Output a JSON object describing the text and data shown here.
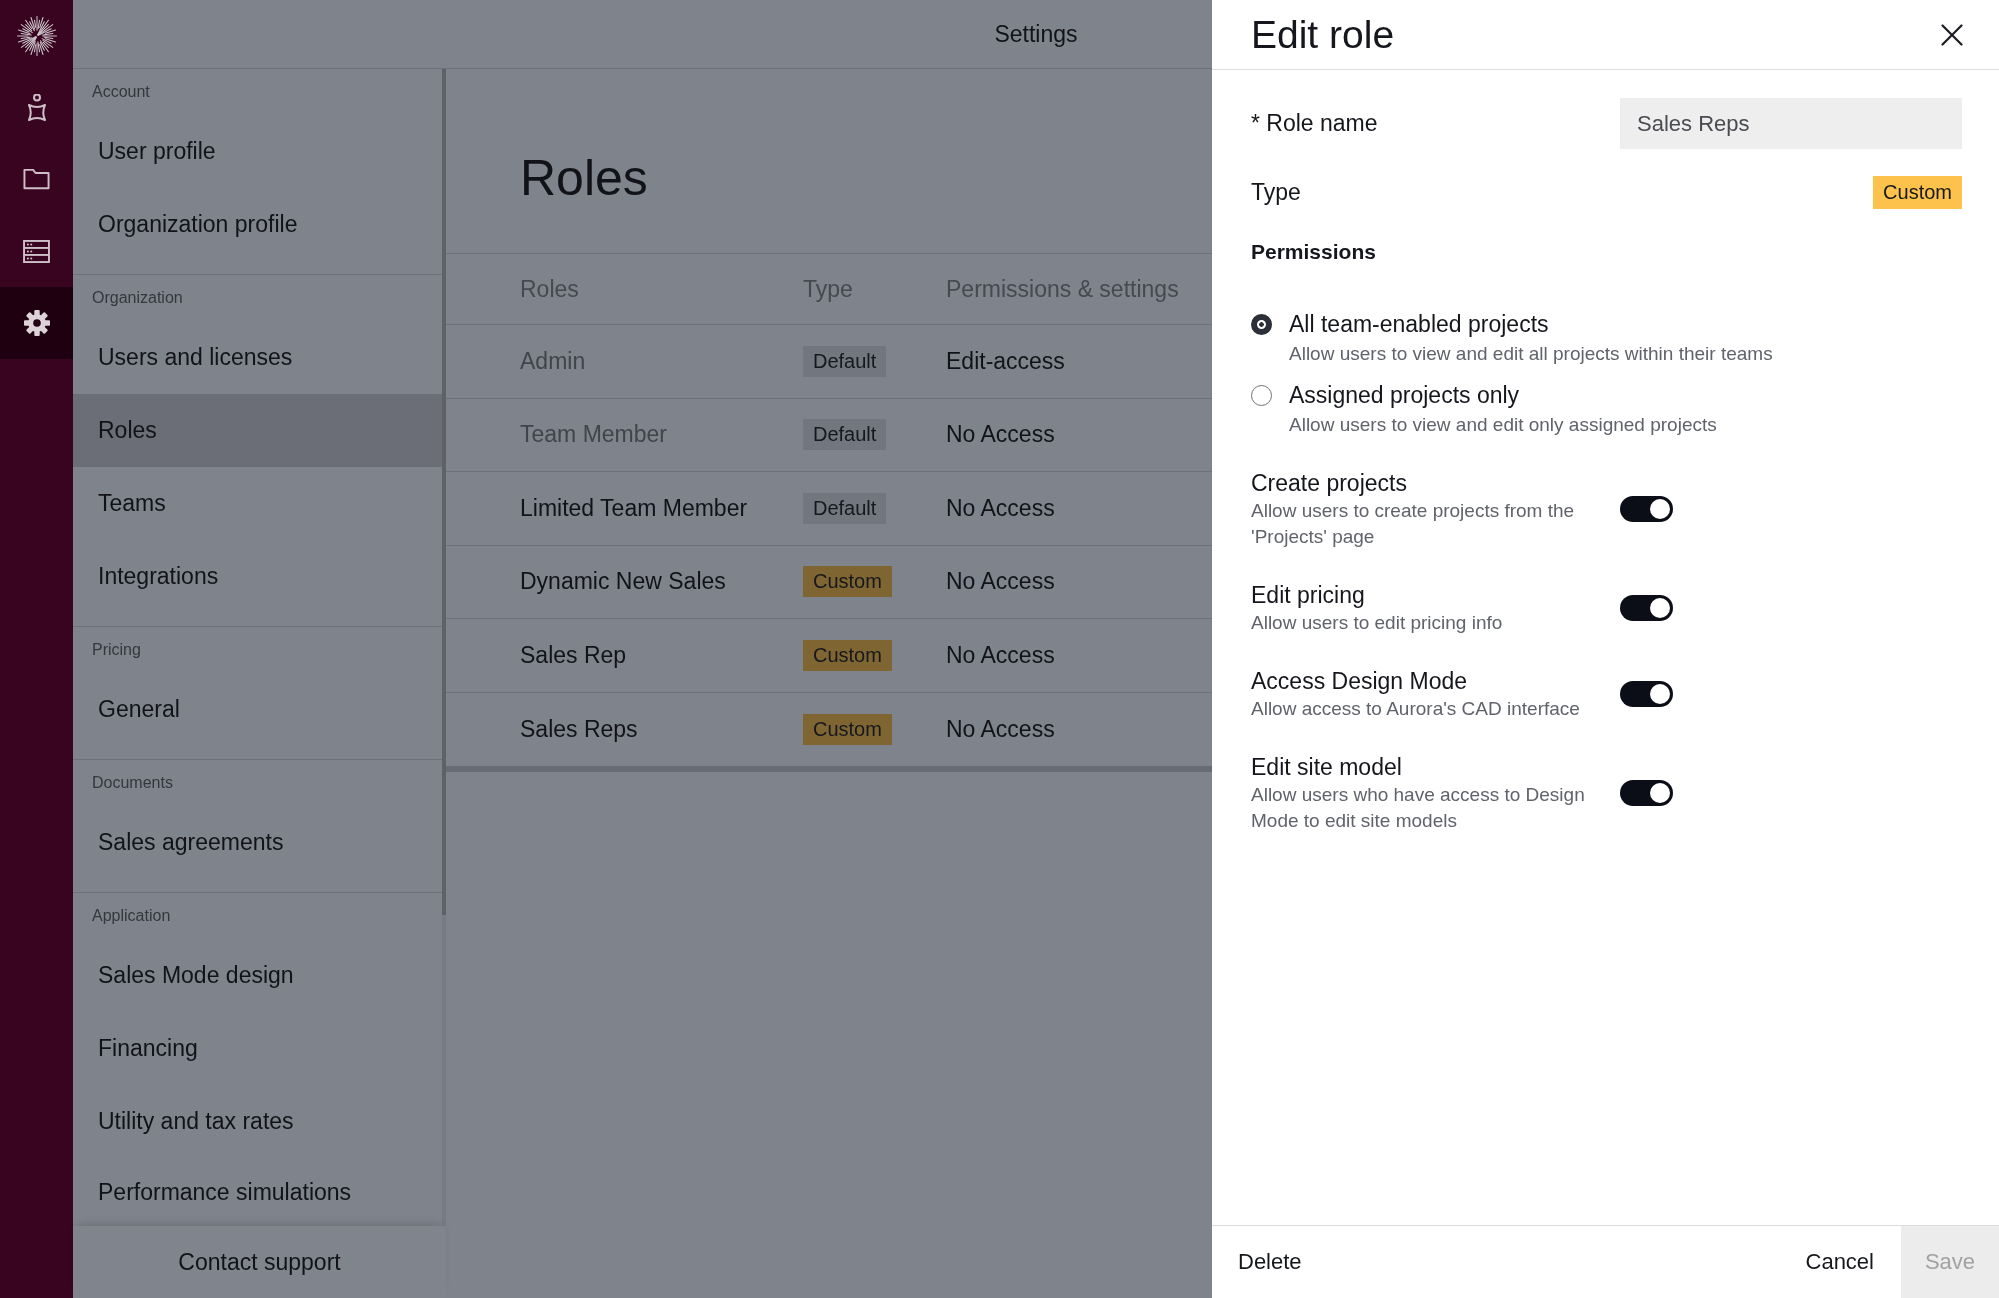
{
  "rail": {
    "items": [
      {
        "selected": false
      },
      {
        "selected": false
      },
      {
        "selected": false
      },
      {
        "selected": true
      }
    ]
  },
  "header": {
    "title": "Settings"
  },
  "sidebar": {
    "sections": [
      {
        "label": "Account",
        "items": [
          {
            "label": "User profile",
            "selected": false
          },
          {
            "label": "Organization profile",
            "selected": false
          }
        ]
      },
      {
        "label": "Organization",
        "items": [
          {
            "label": "Users and licenses",
            "selected": false
          },
          {
            "label": "Roles",
            "selected": true
          },
          {
            "label": "Teams",
            "selected": false
          },
          {
            "label": "Integrations",
            "selected": false
          }
        ]
      },
      {
        "label": "Pricing",
        "items": [
          {
            "label": "General",
            "selected": false
          }
        ]
      },
      {
        "label": "Documents",
        "items": [
          {
            "label": "Sales agreements",
            "selected": false
          }
        ]
      },
      {
        "label": "Application",
        "items": [
          {
            "label": "Sales Mode design",
            "selected": false
          },
          {
            "label": "Financing",
            "selected": false
          },
          {
            "label": "Utility and tax rates",
            "selected": false
          },
          {
            "label": "Performance simulations",
            "selected": false
          }
        ]
      }
    ],
    "footer_link": "Contact support"
  },
  "roles_page": {
    "title": "Roles",
    "table": {
      "columns": [
        "Roles",
        "Type",
        "Permissions & settings"
      ],
      "rows": [
        {
          "name": "Admin",
          "disabled": true,
          "type": {
            "label": "Default",
            "kind": "default"
          },
          "permissions": "Edit-access"
        },
        {
          "name": "Team Member",
          "disabled": true,
          "type": {
            "label": "Default",
            "kind": "default"
          },
          "permissions": "No Access"
        },
        {
          "name": "Limited Team Member",
          "disabled": false,
          "type": {
            "label": "Default",
            "kind": "default"
          },
          "permissions": "No Access"
        },
        {
          "name": "Dynamic New Sales",
          "disabled": false,
          "type": {
            "label": "Custom",
            "kind": "custom"
          },
          "permissions": "No Access"
        },
        {
          "name": "Sales Rep",
          "disabled": false,
          "type": {
            "label": "Custom",
            "kind": "custom"
          },
          "permissions": "No Access"
        },
        {
          "name": "Sales Reps",
          "disabled": false,
          "type": {
            "label": "Custom",
            "kind": "custom"
          },
          "permissions": "No Access"
        }
      ]
    }
  },
  "edit_role": {
    "title": "Edit role",
    "role_name": {
      "label": "* Role name",
      "value": "Sales Reps"
    },
    "type": {
      "label": "Type",
      "badge": {
        "label": "Custom",
        "kind": "custom"
      }
    },
    "permissions": {
      "heading": "Permissions",
      "scope_options": [
        {
          "label": "All team-enabled projects",
          "description": "Allow users to view and edit all projects within their teams",
          "selected": true
        },
        {
          "label": "Assigned projects only",
          "description": "Allow users to view and edit only assigned projects",
          "selected": false
        }
      ],
      "toggles": [
        {
          "label": "Create projects",
          "description": "Allow users to create projects from the 'Projects' page",
          "on": true
        },
        {
          "label": "Edit pricing",
          "description": "Allow users to edit pricing info",
          "on": true
        },
        {
          "label": "Access Design Mode",
          "description": "Allow access to Aurora's CAD interface",
          "on": true
        },
        {
          "label": "Edit site model",
          "description": "Allow users who have access to Design Mode to edit site models",
          "on": true
        }
      ]
    },
    "footer": {
      "delete": "Delete",
      "cancel": "Cancel",
      "save": {
        "label": "Save",
        "disabled": true
      }
    }
  }
}
